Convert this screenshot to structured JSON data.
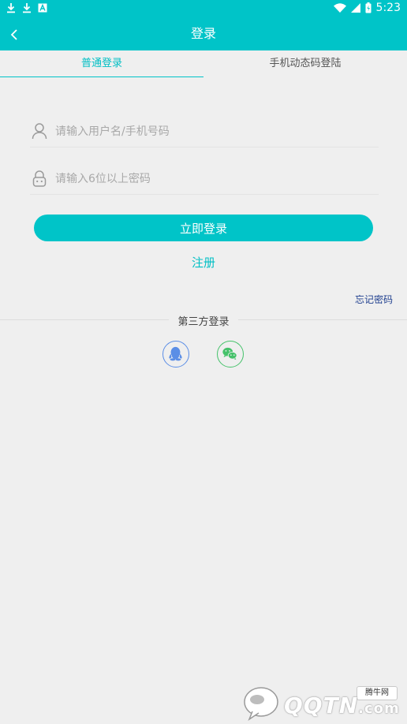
{
  "status_bar": {
    "time": "5:23"
  },
  "header": {
    "title": "登录"
  },
  "tabs": [
    {
      "label": "普通登录",
      "active": true
    },
    {
      "label": "手机动态码登陆",
      "active": false
    }
  ],
  "form": {
    "username_placeholder": "请输入用户名/手机号码",
    "password_placeholder": "请输入6位以上密码",
    "login_button": "立即登录",
    "register_link": "注册",
    "forgot_link": "忘记密码"
  },
  "third_party": {
    "label": "第三方登录",
    "providers": [
      "qq-icon",
      "wechat-icon"
    ]
  },
  "watermark": {
    "badge": "腾牛网",
    "brand": "QQTN",
    "domain": ".com"
  },
  "colors": {
    "accent": "#00c4c8",
    "qq": "#5b8ee6",
    "wechat": "#45c26a",
    "forgot": "#1f3f8f"
  }
}
